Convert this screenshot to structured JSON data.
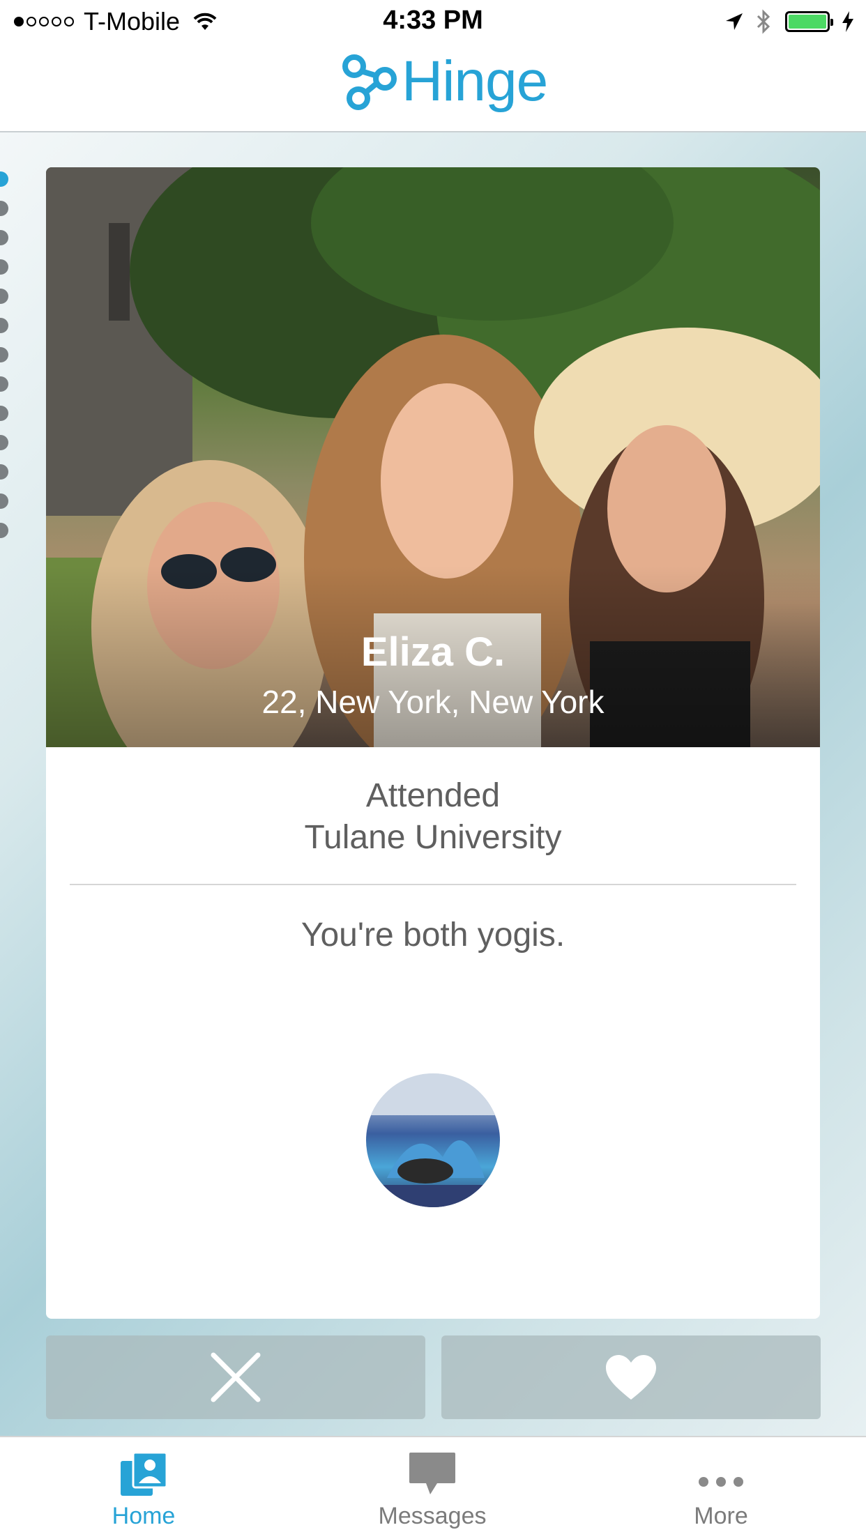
{
  "status_bar": {
    "carrier": "T-Mobile",
    "time": "4:33 PM",
    "signal_bars": 1,
    "signal_total": 5,
    "battery_level": 1.0,
    "icons": [
      "wifi-icon",
      "location-arrow-icon",
      "bluetooth-icon",
      "battery-icon",
      "charging-bolt-icon"
    ]
  },
  "header": {
    "logo_text": "Hinge",
    "brand_color": "#27a3d6"
  },
  "pager": {
    "count": 13,
    "active_index": 0
  },
  "profile": {
    "name": "Eliza C.",
    "details": "22, New York, New York",
    "education_line1": "Attended",
    "education_line2": "Tulane University",
    "shared_interest": "You're both yogis."
  },
  "actions": {
    "pass_icon": "close-icon",
    "like_icon": "heart-icon"
  },
  "tabs": [
    {
      "label": "Home",
      "icon": "home-cards-icon",
      "active": true
    },
    {
      "label": "Messages",
      "icon": "chat-bubble-icon",
      "active": false
    },
    {
      "label": "More",
      "icon": "more-dots-icon",
      "active": false
    }
  ],
  "colors": {
    "accent": "#27a3d6",
    "inactive_tab": "#7b7b7b",
    "battery": "#4cd964"
  }
}
